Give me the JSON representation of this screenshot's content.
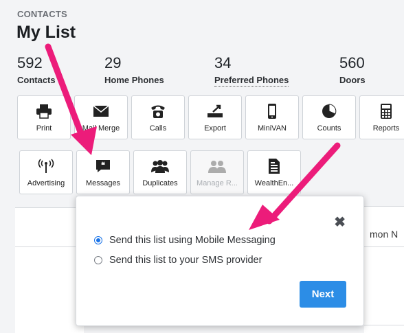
{
  "header": {
    "eyebrow": "CONTACTS",
    "title": "My List"
  },
  "stats": [
    {
      "value": "592",
      "label": "Contacts"
    },
    {
      "value": "29",
      "label": "Home Phones"
    },
    {
      "value": "34",
      "label": "Preferred Phones"
    },
    {
      "value": "560",
      "label": "Doors"
    }
  ],
  "toolbar_row1": [
    {
      "label": "Print",
      "icon": "print-icon"
    },
    {
      "label": "Mail Merge",
      "icon": "envelope-icon"
    },
    {
      "label": "Calls",
      "icon": "phone-icon"
    },
    {
      "label": "Export",
      "icon": "export-icon"
    },
    {
      "label": "MiniVAN",
      "icon": "mobile-icon"
    },
    {
      "label": "Counts",
      "icon": "pie-chart-icon"
    },
    {
      "label": "Reports",
      "icon": "calculator-icon"
    }
  ],
  "toolbar_row2": [
    {
      "label": "Advertising",
      "icon": "broadcast-icon"
    },
    {
      "label": "Messages",
      "icon": "message-icon"
    },
    {
      "label": "Duplicates",
      "icon": "people-icon"
    },
    {
      "label": "Manage R...",
      "icon": "people-icon",
      "disabled": true
    },
    {
      "label": "WealthEn...",
      "icon": "document-icon"
    }
  ],
  "background": {
    "right_column_text": "mon N"
  },
  "popover": {
    "options": [
      {
        "label": "Send this list using Mobile Messaging",
        "selected": true
      },
      {
        "label": "Send this list to your SMS provider",
        "selected": false
      }
    ],
    "next_label": "Next",
    "close_glyph": "✖"
  },
  "colors": {
    "accent": "#2c8de6",
    "annotation_arrow": "#ec1c7a"
  }
}
